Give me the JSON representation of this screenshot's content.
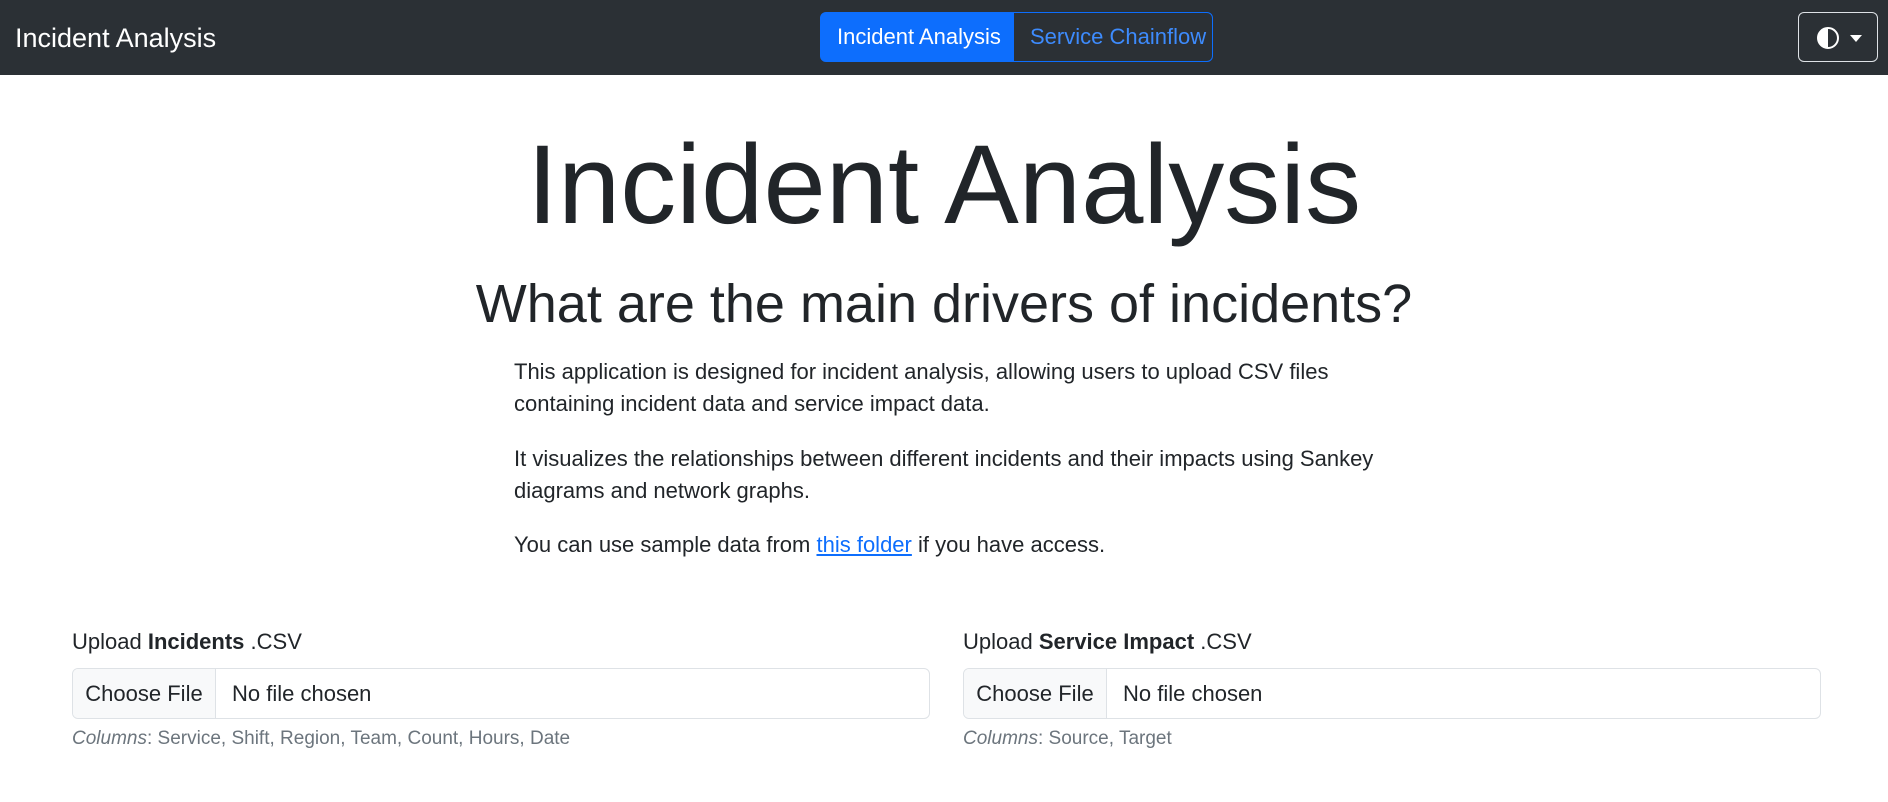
{
  "navbar": {
    "brand": "Incident Analysis",
    "tabs": [
      {
        "label": "Incident Analysis",
        "active": true
      },
      {
        "label": "Service Chainflow",
        "active": false
      }
    ],
    "theme_toggle_icon": "contrast-half-circle-icon"
  },
  "main": {
    "title": "Incident Analysis",
    "question": "What are the main drivers of incidents?",
    "paragraph1": "This application is designed for incident analysis, allowing users to upload CSV files containing incident data and service impact data.",
    "paragraph2": "It visualizes the relationships between different incidents and their impacts using Sankey diagrams and network graphs.",
    "paragraph3_before": "You can use sample data from ",
    "paragraph3_link": "this folder",
    "paragraph3_after": " if you have access."
  },
  "uploads": [
    {
      "label_prefix": "Upload ",
      "label_bold": "Incidents",
      "label_suffix": " .CSV",
      "button_label": "Choose File",
      "file_status": "No file chosen",
      "hint_label": "Columns",
      "hint_text": ": Service, Shift, Region, Team, Count, Hours, Date"
    },
    {
      "label_prefix": "Upload ",
      "label_bold": "Service Impact",
      "label_suffix": " .CSV",
      "button_label": "Choose File",
      "file_status": "No file chosen",
      "hint_label": "Columns",
      "hint_text": ": Source, Target"
    }
  ],
  "colors": {
    "navbar_bg": "#2b3035",
    "primary": "#0d6efd",
    "text": "#212529",
    "muted": "#6c757d"
  }
}
